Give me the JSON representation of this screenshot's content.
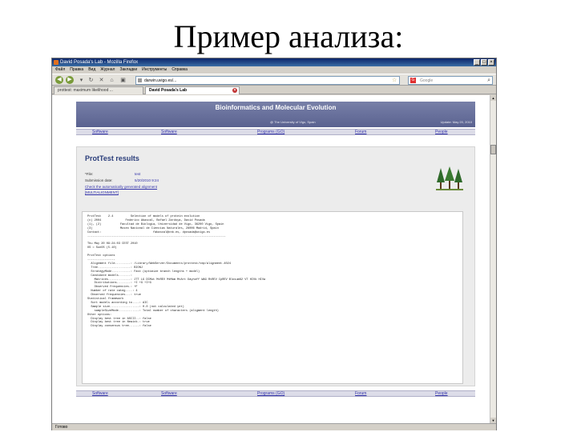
{
  "slide": {
    "title": "Пример анализа:"
  },
  "window": {
    "title": "David Posada's Lab - Mozilla Firefox",
    "controls": [
      "_",
      "□",
      "×"
    ]
  },
  "menu": [
    "Файл",
    "Правка",
    "Вид",
    "Журнал",
    "Закладки",
    "Инструменты",
    "Справка"
  ],
  "toolbar": {
    "back": "◀",
    "forward": "▶",
    "reload": "↻",
    "stop": "✕",
    "home": "⌂",
    "url": "darwin.uvigo.es/...",
    "search_engine": "G",
    "search_placeholder": "Google"
  },
  "tabs": [
    {
      "label": "prottest: maximum likelihood ...",
      "active": false
    },
    {
      "label": "David Posada's Lab",
      "active": true
    }
  ],
  "status": "Готово",
  "site": {
    "title": "Bioinformatics and Molecular Evolution",
    "subtitle": "@ The University of Vigo, Spain",
    "updated": "Update: May 20, 2010",
    "nav": [
      "Software",
      "Software",
      "Programs (GO)",
      "Forum",
      "People"
    ]
  },
  "results": {
    "title": "ProtTest results",
    "rows": [
      {
        "label": "*File:",
        "value": "test"
      },
      {
        "label": "Submission date:",
        "value": "5/20/2010 9:24"
      }
    ],
    "links": [
      "Check the automatically generated alignment",
      "[MULTIALIGNMENT]"
    ]
  },
  "output_lines": [
    "ProtTest    2.4          Selection of models of protein evolution",
    "(c) 2004              Federico Abascal, Rafael Zardoya, David Posada",
    "(1), (2)           Facultad de Biologia, Universidad de Vigo, 36200 Vigo, Spain",
    "(3)                Museo Nacional de Ciencias Naturales, 28006 Madrid, Spain",
    "Contact:                              fabascal@cnb.es, dposada@uvigo.es",
    "--------------------------------------------------------------------------------",
    "",
    "Thu May 20 09:24:03 CEST 2010",
    "OS = SunOS (5.10)",
    "",
    "ProtTest options",
    "----------------",
    "  Alignment file.........: /Library/WebServer/Documents/prottest/tmp/alignment.4024",
    "  Tree...................: BIONJ",
    "  StrategyMode...........: Fast (optimize branch lengths + model)",
    "  Candidate models.......:",
    "    Matrices.............: JTT LG DCMut MtREV MtMam MtArt Dayhoff WAG RtREV CpREV Blosum62 VT HIVb HIVw",
    "    Distributions........: +I +G +I+G",
    "    Observed frequencies.: +F",
    "  Number of rate categ....: 4",
    "  Observed frequencies...: true",
    "Statistical framework",
    "  Sort models according to....: AIC",
    "  Sample size.................: 0.0 (not calculated yet)",
    "    sampleSizeMode............: Total number of characters (aligment length)",
    "Other options:",
    "  Display best tree in ASCII..: false",
    "  Display best tree in Newick.: true",
    "  Display consensus tree......: false"
  ]
}
